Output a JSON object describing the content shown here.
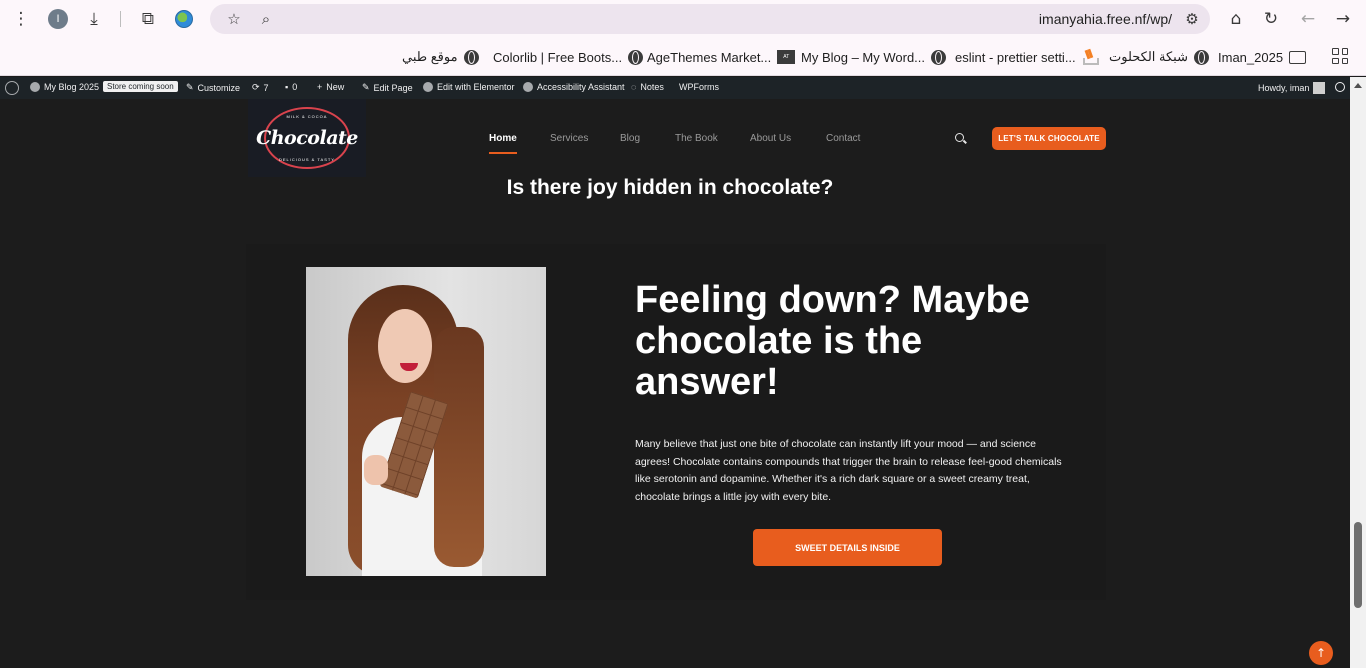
{
  "browser": {
    "profile_initial": "I",
    "url": "imanyahia.free.nf/wp/",
    "icons": [
      "menu-icon",
      "download-icon",
      "extensions-icon",
      "star-icon",
      "zoom-icon",
      "tune-icon",
      "home-icon",
      "reload-icon",
      "back-icon",
      "forward-icon"
    ]
  },
  "bookmarks": [
    {
      "label": "موقع طبي",
      "icon": "globe"
    },
    {
      "label": "Colorlib | Free Boots...",
      "icon": "globe"
    },
    {
      "label": "AgeThemes Market...",
      "icon": "agethemes"
    },
    {
      "label": "My Blog – My Word...",
      "icon": "globe"
    },
    {
      "label": "eslint - prettier setti...",
      "icon": "stackoverflow"
    },
    {
      "label": "شبكة الكحلوت",
      "icon": "globe"
    },
    {
      "label": "Iman_2025",
      "icon": "folder"
    }
  ],
  "adminbar": {
    "site_name": "My Blog 2025",
    "store_badge": "Store coming soon",
    "customize": "Customize",
    "updates": "7",
    "comments": "0",
    "new": "New",
    "edit_page": "Edit Page",
    "edit_elementor": "Edit with Elementor",
    "accessibility": "Accessibility Assistant",
    "notes": "Notes",
    "wpforms": "WPForms",
    "howdy": "Howdy, iman"
  },
  "site": {
    "logo_text": "Chocolate",
    "logo_top": "MILK & COCOA",
    "logo_bottom": "DELICIOUS & TASTY",
    "nav": [
      "Home",
      "Services",
      "Blog",
      "The Book",
      "About Us",
      "Contact"
    ],
    "active_nav": "Home",
    "cta_top": "LET'S TALK CHOCOLATE",
    "accent": "#e85d1e"
  },
  "main": {
    "section_title": "Is there joy hidden in chocolate?",
    "headline": "Feeling down? Maybe chocolate is the answer!",
    "body": "Many believe that just one bite of chocolate can instantly lift your mood — and science agrees! Chocolate contains compounds that trigger the brain to release feel-good chemicals like serotonin and dopamine. Whether it's a rich dark square or a sweet creamy treat, chocolate brings a little joy with every bite.",
    "cta": "SWEET DETAILS INSIDE"
  }
}
